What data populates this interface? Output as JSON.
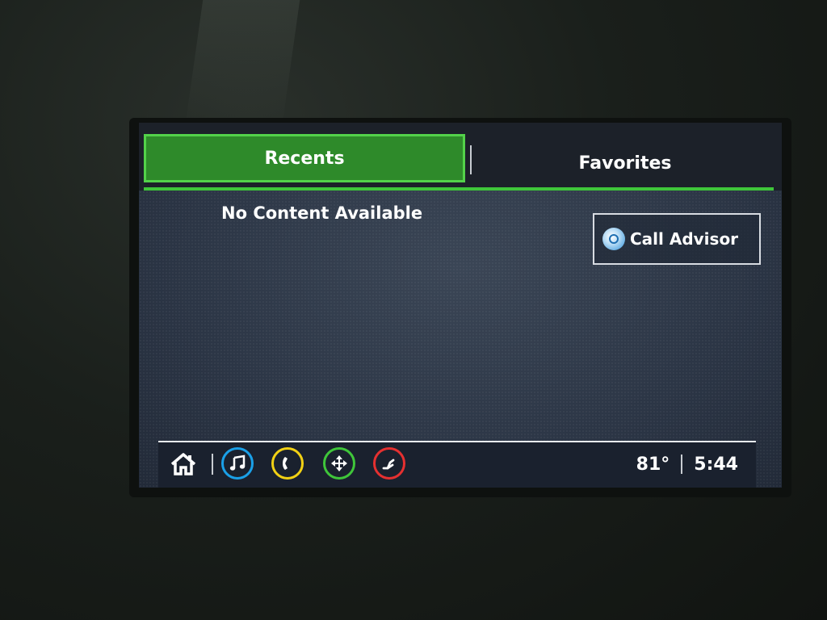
{
  "tabs": {
    "recents": "Recents",
    "favorites": "Favorites"
  },
  "main": {
    "empty_message": "No Content Available",
    "call_advisor_label": "Call Advisor"
  },
  "bottom_bar": {
    "icons": [
      "home-icon",
      "music-icon",
      "phone-icon",
      "navigation-icon",
      "seat-icon"
    ],
    "temperature": "81°",
    "time": "5:44"
  },
  "colors": {
    "active_tab": "#2e8a2a",
    "accent_green": "#3fc63a",
    "music_blue": "#1aa0e8",
    "phone_yellow": "#f2d114",
    "nav_green": "#3fc63a",
    "seat_red": "#e53030"
  }
}
